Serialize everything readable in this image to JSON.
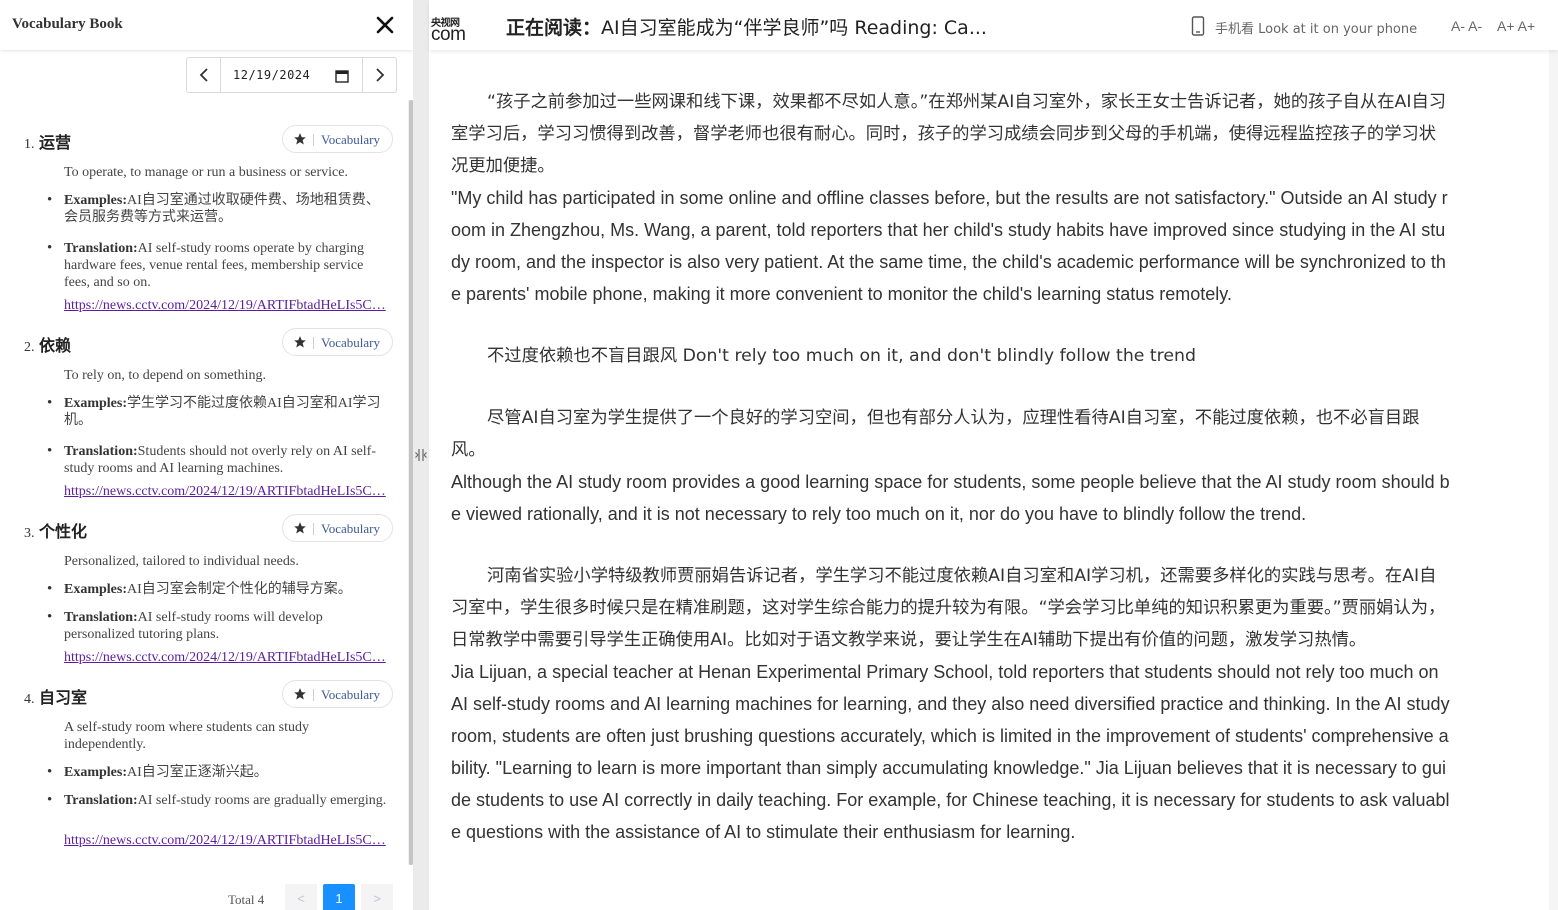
{
  "vocab_panel": {
    "title": "Vocabulary Book",
    "date": "12/19/2024",
    "entries": [
      {
        "number": "1.",
        "word": "运营",
        "button_label": "Vocabulary",
        "definition": "To operate, to manage or run a business or service.",
        "examples_label": "Examples:",
        "examples": "AI自习室通过收取硬件费、场地租赁费、会员服务费等方式来运营。",
        "translation_label": "Translation:",
        "translation": "AI self-study rooms operate by charging hardware fees, venue rental fees, membership service fees, and so on.",
        "link": "https://news.cctv.com/2024/12/19/ARTIFbtadHeLIs5C…"
      },
      {
        "number": "2.",
        "word": "依赖",
        "button_label": "Vocabulary",
        "definition": "To rely on, to depend on something.",
        "examples_label": "Examples:",
        "examples": "学生学习不能过度依赖AI自习室和AI学习机。",
        "translation_label": "Translation:",
        "translation": "Students should not overly rely on AI self-study rooms and AI learning machines.",
        "link": "https://news.cctv.com/2024/12/19/ARTIFbtadHeLIs5C…"
      },
      {
        "number": "3.",
        "word": "个性化",
        "button_label": "Vocabulary",
        "definition": "Personalized, tailored to individual needs.",
        "examples_label": "Examples:",
        "examples": "AI自习室会制定个性化的辅导方案。",
        "translation_label": "Translation:",
        "translation": "AI self-study rooms will develop personalized tutoring plans.",
        "link": "https://news.cctv.com/2024/12/19/ARTIFbtadHeLIs5C…"
      },
      {
        "number": "4.",
        "word": "自习室",
        "button_label": "Vocabulary",
        "definition": "A self-study room where students can study independently.",
        "examples_label": "Examples:",
        "examples": "AI自习室正逐渐兴起。",
        "translation_label": "Translation:",
        "translation": "AI self-study rooms are gradually emerging.",
        "link": "https://news.cctv.com/2024/12/19/ARTIFbtadHeLIs5C…"
      }
    ],
    "pagination": {
      "total": "Total 4",
      "prev": "<",
      "current": "1",
      "next": ">"
    }
  },
  "reader": {
    "logo_cn": "央视网",
    "logo_com": "com",
    "reading_prefix": "正在阅读：",
    "reading_title": "AI自习室能成为“伴学良师”吗 Reading: Ca...",
    "phone_text": "手机看 Look at it on your phone",
    "font_small": "A- A-",
    "font_large": "A+ A+",
    "paragraphs": [
      {
        "type": "zh",
        "text": "“孩子之前参加过一些网课和线下课，效果都不尽如人意。”在郑州某AI自习室外，家长王女士告诉记者，她的孩子自从在AI自习室学习后，学习习惯得到改善，督学老师也很有耐心。同时，孩子的学习成绩会同步到父母的手机端，使得远程监控孩子的学习状况更加便捷。"
      },
      {
        "type": "en",
        "text": "\"My child has participated in some online and offline classes before, but the results are not satisfactory.\" Outside an AI study room in Zhengzhou, Ms. Wang, a parent, told reporters that her child's study habits have improved since studying in the AI study room, and the inspector is also very patient. At the same time, the child's academic performance will be synchronized to the parents' mobile phone, making it more convenient to monitor the child's learning status remotely."
      },
      {
        "type": "heading",
        "text": "不过度依赖也不盲目跟风 Don't rely too much on it, and don't blindly follow the trend"
      },
      {
        "type": "zh",
        "text": "尽管AI自习室为学生提供了一个良好的学习空间，但也有部分人认为，应理性看待AI自习室，不能过度依赖，也不必盲目跟风。"
      },
      {
        "type": "en",
        "text": "Although the AI study room provides a good learning space for students, some people believe that the AI study room should be viewed rationally, and it is not necessary to rely too much on it, nor do you have to blindly follow the trend."
      },
      {
        "type": "zh",
        "text": "河南省实验小学特级教师贾丽娟告诉记者，学生学习不能过度依赖AI自习室和AI学习机，还需要多样化的实践与思考。在AI自习室中，学生很多时候只是在精准刷题，这对学生综合能力的提升较为有限。“学会学习比单纯的知识积累更为重要。”贾丽娟认为，日常教学中需要引导学生正确使用AI。比如对于语文教学来说，要让学生在AI辅助下提出有价值的问题，激发学习热情。"
      },
      {
        "type": "en",
        "text": "Jia Lijuan, a special teacher at Henan Experimental Primary School, told reporters that students should not rely too much on AI self-study rooms and AI learning machines for learning, and they also need diversified practice and thinking. In the AI study room, students are often just brushing questions accurately, which is limited in the improvement of students' comprehensive ability. \"Learning to learn is more important than simply accumulating knowledge.\" Jia Lijuan believes that it is necessary to guide students to use AI correctly in daily teaching. For example, for Chinese teaching, it is necessary for students to ask valuable questions with the assistance of AI to stimulate their enthusiasm for learning."
      }
    ]
  },
  "colors": {
    "accent_blue": "#1890ff",
    "link_purple": "#5b1d9e",
    "vocab_label": "#3b5998"
  }
}
